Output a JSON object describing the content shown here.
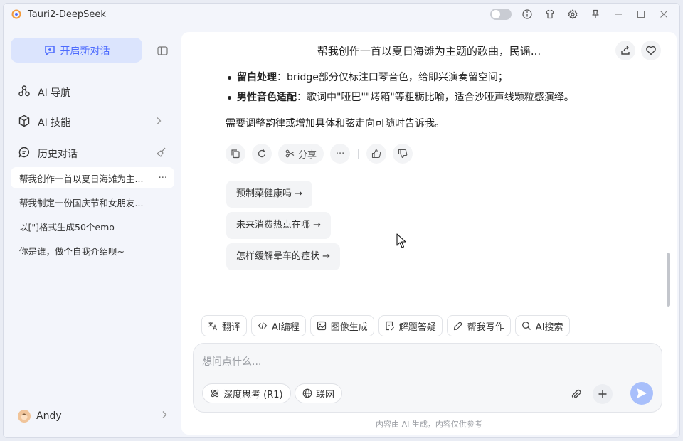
{
  "window": {
    "title": "Tauri2-DeepSeek"
  },
  "sidebar": {
    "new_chat_label": "开启新对话",
    "nav": [
      {
        "label": "AI 导航",
        "icon": "nodes-icon"
      },
      {
        "label": "AI 技能",
        "icon": "cube-icon"
      }
    ],
    "history_label": "历史对话",
    "history": [
      {
        "title": "帮我创作一首以夏日海滩为主...",
        "active": true
      },
      {
        "title": "帮我制定一份国庆节和女朋友..."
      },
      {
        "title": "以[\"]格式生成50个emo"
      },
      {
        "title": "你是谁，做个自我介绍呗~"
      }
    ],
    "user_name": "Andy"
  },
  "chat": {
    "title": "帮我创作一首以夏日海滩为主题的歌曲，民谣...",
    "bullets": [
      {
        "term": "留白处理",
        "text": "：bridge部分仅标注口琴音色，给即兴演奏留空间；"
      },
      {
        "term": "男性音色适配",
        "text": "：歌词中\"哑巴\"\"烤箱\"等粗粝比喻，适合沙哑声线颗粒感演绎。"
      }
    ],
    "closing": "需要调整韵律或增加具体和弦走向可随时告诉我。",
    "share_label": "分享",
    "suggestions": [
      "预制菜健康吗 →",
      "未来消费热点在哪 →",
      "怎样缓解晕车的症状 →"
    ]
  },
  "tools": [
    "翻译",
    "AI编程",
    "图像生成",
    "解题答疑",
    "帮我写作",
    "AI搜索"
  ],
  "composer": {
    "placeholder": "想问点什么...",
    "deep_think_label": "深度思考 (R1)",
    "web_label": "联网"
  },
  "disclaimer": "内容由 AI 生成，内容仅供参考",
  "colors": {
    "accent": "#4d6bfe",
    "accent_light": "#dbe4fd",
    "send_disabled": "#a8bffb"
  }
}
